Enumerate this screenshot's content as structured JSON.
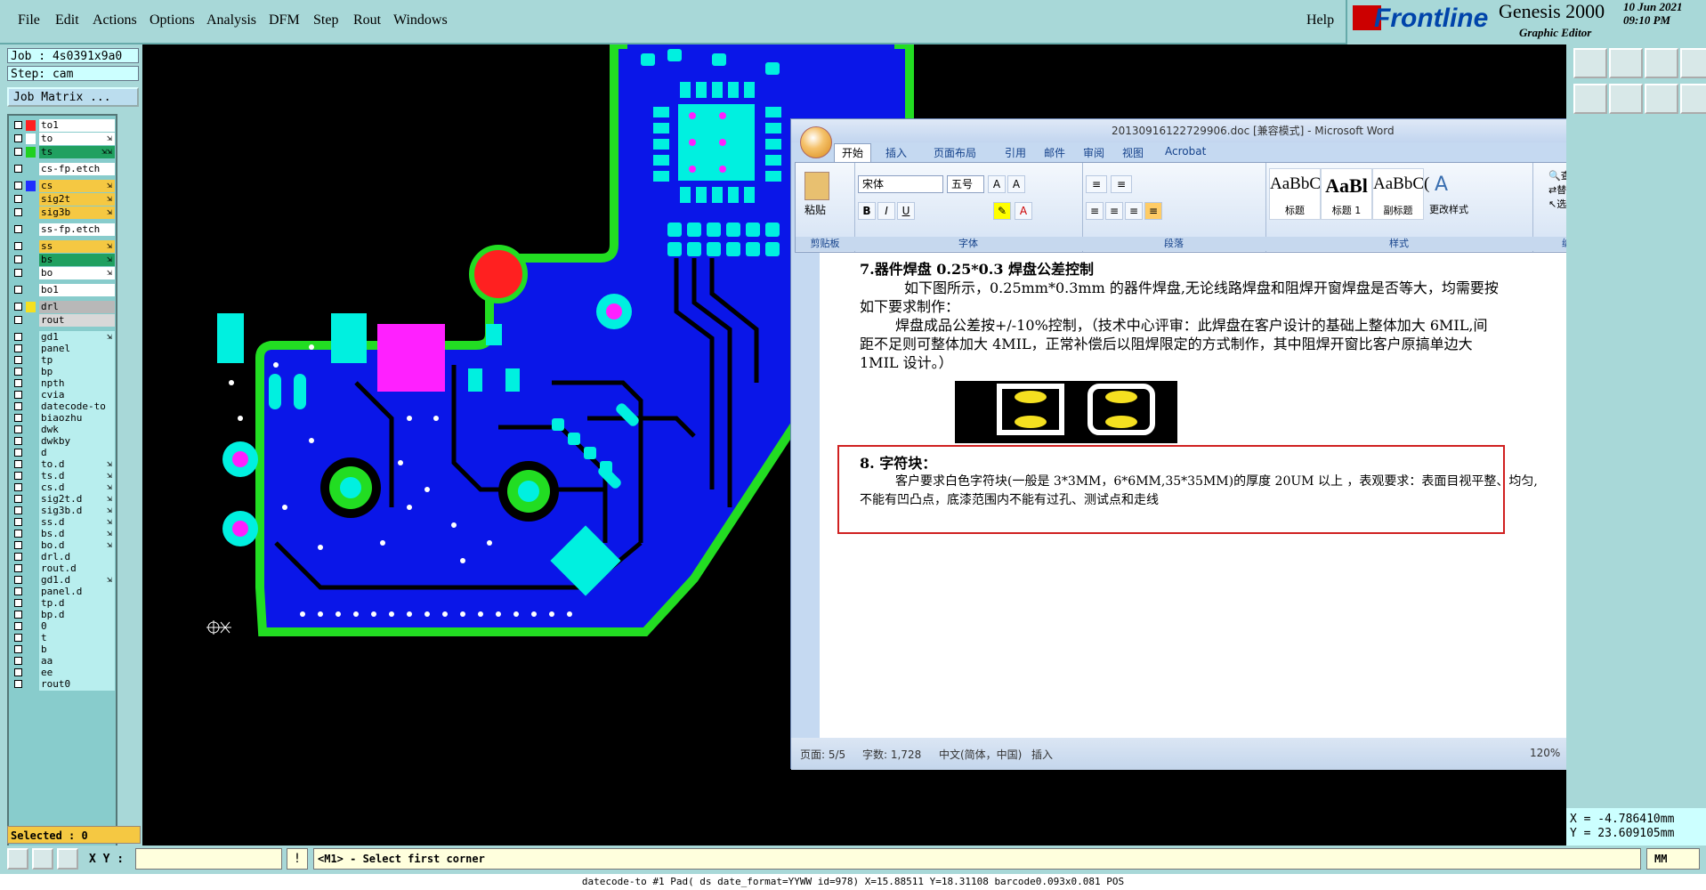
{
  "menu": [
    "File",
    "Edit",
    "Actions",
    "Options",
    "Analysis",
    "DFM",
    "Step",
    "Rout",
    "Windows"
  ],
  "help": "Help",
  "brand": {
    "logo": "Frontline",
    "product": "Genesis 2000",
    "editor": "Graphic Editor",
    "date": "10 Jun 2021",
    "time": "09:10 PM"
  },
  "job": {
    "job_line": "Job  : 4s0391x9a0",
    "step_line": "Step: cam",
    "matrix_label": "Job Matrix ..."
  },
  "layers": [
    {
      "name": "to1",
      "color": "#ff2020",
      "bg": "#ffffff",
      "arrow": ""
    },
    {
      "name": "to",
      "color": "#ffffff",
      "bg": "#ffffff",
      "arrow": "⇲"
    },
    {
      "name": "ts",
      "color": "#20d020",
      "bg": "#20a060",
      "arrow": "⇲⇲"
    },
    {
      "name": "cs-fp.etch",
      "color": "",
      "bg": "#ffffff",
      "arrow": ""
    },
    {
      "name": "cs",
      "color": "#2030ff",
      "bg": "#f5c842",
      "arrow": "⇲"
    },
    {
      "name": "sig2t",
      "color": "",
      "bg": "#f5c842",
      "arrow": "⇲"
    },
    {
      "name": "sig3b",
      "color": "",
      "bg": "#f5c842",
      "arrow": "⇲"
    },
    {
      "name": "ss-fp.etch",
      "color": "",
      "bg": "#ffffff",
      "arrow": ""
    },
    {
      "name": "ss",
      "color": "",
      "bg": "#f5c842",
      "arrow": "⇲"
    },
    {
      "name": "bs",
      "color": "",
      "bg": "#20a060",
      "arrow": "⇲"
    },
    {
      "name": "bo",
      "color": "",
      "bg": "#ffffff",
      "arrow": "⇲"
    },
    {
      "name": "bo1",
      "color": "",
      "bg": "#ffffff",
      "arrow": ""
    },
    {
      "name": "drl",
      "color": "#f5e020",
      "bg": "#b8b8b8",
      "arrow": ""
    },
    {
      "name": "rout",
      "color": "",
      "bg": "#d8d8d8",
      "arrow": ""
    },
    {
      "name": "gd1",
      "color": "",
      "bg": "#b8eeee",
      "arrow": "⇲"
    },
    {
      "name": "panel",
      "color": "",
      "bg": "#b8eeee",
      "arrow": ""
    },
    {
      "name": "tp",
      "color": "",
      "bg": "#b8eeee",
      "arrow": ""
    },
    {
      "name": "bp",
      "color": "",
      "bg": "#b8eeee",
      "arrow": ""
    },
    {
      "name": "npth",
      "color": "",
      "bg": "#b8eeee",
      "arrow": ""
    },
    {
      "name": "cvia",
      "color": "",
      "bg": "#b8eeee",
      "arrow": ""
    },
    {
      "name": "datecode-to",
      "color": "",
      "bg": "#b8eeee",
      "arrow": ""
    },
    {
      "name": "biaozhu",
      "color": "",
      "bg": "#b8eeee",
      "arrow": ""
    },
    {
      "name": "dwk",
      "color": "",
      "bg": "#b8eeee",
      "arrow": ""
    },
    {
      "name": "dwkby",
      "color": "",
      "bg": "#b8eeee",
      "arrow": ""
    },
    {
      "name": "d",
      "color": "",
      "bg": "#b8eeee",
      "arrow": ""
    },
    {
      "name": "to.d",
      "color": "",
      "bg": "#b8eeee",
      "arrow": "⇲"
    },
    {
      "name": "ts.d",
      "color": "",
      "bg": "#b8eeee",
      "arrow": "⇲"
    },
    {
      "name": "cs.d",
      "color": "",
      "bg": "#b8eeee",
      "arrow": "⇲"
    },
    {
      "name": "sig2t.d",
      "color": "",
      "bg": "#b8eeee",
      "arrow": "⇲"
    },
    {
      "name": "sig3b.d",
      "color": "",
      "bg": "#b8eeee",
      "arrow": "⇲"
    },
    {
      "name": "ss.d",
      "color": "",
      "bg": "#b8eeee",
      "arrow": "⇲"
    },
    {
      "name": "bs.d",
      "color": "",
      "bg": "#b8eeee",
      "arrow": "⇲"
    },
    {
      "name": "bo.d",
      "color": "",
      "bg": "#b8eeee",
      "arrow": "⇲"
    },
    {
      "name": "drl.d",
      "color": "",
      "bg": "#b8eeee",
      "arrow": ""
    },
    {
      "name": "rout.d",
      "color": "",
      "bg": "#b8eeee",
      "arrow": ""
    },
    {
      "name": "gd1.d",
      "color": "",
      "bg": "#b8eeee",
      "arrow": "⇲"
    },
    {
      "name": "panel.d",
      "color": "",
      "bg": "#b8eeee",
      "arrow": ""
    },
    {
      "name": "tp.d",
      "color": "",
      "bg": "#b8eeee",
      "arrow": ""
    },
    {
      "name": "bp.d",
      "color": "",
      "bg": "#b8eeee",
      "arrow": ""
    },
    {
      "name": "0",
      "color": "",
      "bg": "#b8eeee",
      "arrow": ""
    },
    {
      "name": "t",
      "color": "",
      "bg": "#b8eeee",
      "arrow": ""
    },
    {
      "name": "b",
      "color": "",
      "bg": "#b8eeee",
      "arrow": ""
    },
    {
      "name": "aa",
      "color": "",
      "bg": "#b8eeee",
      "arrow": ""
    },
    {
      "name": "ee",
      "color": "",
      "bg": "#b8eeee",
      "arrow": ""
    },
    {
      "name": "rout0",
      "color": "",
      "bg": "#b8eeee",
      "arrow": ""
    }
  ],
  "selected": "Selected : 0",
  "coords": {
    "x": "X = -4.786410mm",
    "y": "Y = 23.609105mm"
  },
  "bottom": {
    "xy_label": "X Y :",
    "xy_value": "",
    "info": "!",
    "message": "<M1> - Select first corner",
    "units": "MM"
  },
  "status_line": "datecode-to  #1  Pad(  ds  date_format=YYWW id=978) X=15.88511 Y=18.31108 barcode0.093x0.081 POS",
  "word": {
    "title": "20130916122729906.doc [兼容模式] - Microsoft Word",
    "tabs": [
      "开始",
      "插入",
      "页面布局",
      "引用",
      "邮件",
      "审阅",
      "视图",
      "Acrobat"
    ],
    "groups": [
      "剪贴板",
      "字体",
      "段落",
      "样式",
      "编辑"
    ],
    "paste": "粘贴",
    "font_name": "宋体",
    "font_size": "五号",
    "styles": [
      {
        "sample": "AaBbC(",
        "name": "标题"
      },
      {
        "sample": "AaBl",
        "name": "标题 1"
      },
      {
        "sample": "AaBbC(",
        "name": "副标题"
      }
    ],
    "change_styles": "更改样式",
    "edit_items": [
      "查找",
      "替换",
      "选择"
    ],
    "doc": {
      "h7": "7.器件焊盘 0.25*0.3 焊盘公差控制",
      "p1a": "如下图所示，0.25mm*0.3mm 的器件焊盘,无论线路焊盘和阻焊开窗焊盘是否等大，均需要按",
      "p1b": "如下要求制作：",
      "p2a": "焊盘成品公差按+/-10%控制，（技术中心评审：此焊盘在客户设计的基础上整体加大 6MIL,间",
      "p2b": "距不足则可整体加大 4MIL，正常补偿后以阻焊限定的方式制作，其中阻焊开窗比客户原搞单边大",
      "p2c": "1MIL 设计。）",
      "h8": "8. 字符块：",
      "p3a": "客户要求白色字符块(一般是 3*3MM，6*6MM,35*35MM)的厚度 20UM 以上 ，表观要求：表面目视平整、均匀,",
      "p3b": "不能有凹凸点，底漆范围内不能有过孔、测试点和走线"
    },
    "status": {
      "page": "页面: 5/5",
      "words": "字数: 1,728",
      "lang": "中文(简体，中国)",
      "mode": "插入",
      "zoom": "120%"
    }
  },
  "colors": {
    "board_blue": "#0a16e8",
    "copper_green": "#22dd22",
    "pad_cyan": "#00f0e0",
    "magenta": "#ff20ff",
    "red": "#ff2020"
  }
}
